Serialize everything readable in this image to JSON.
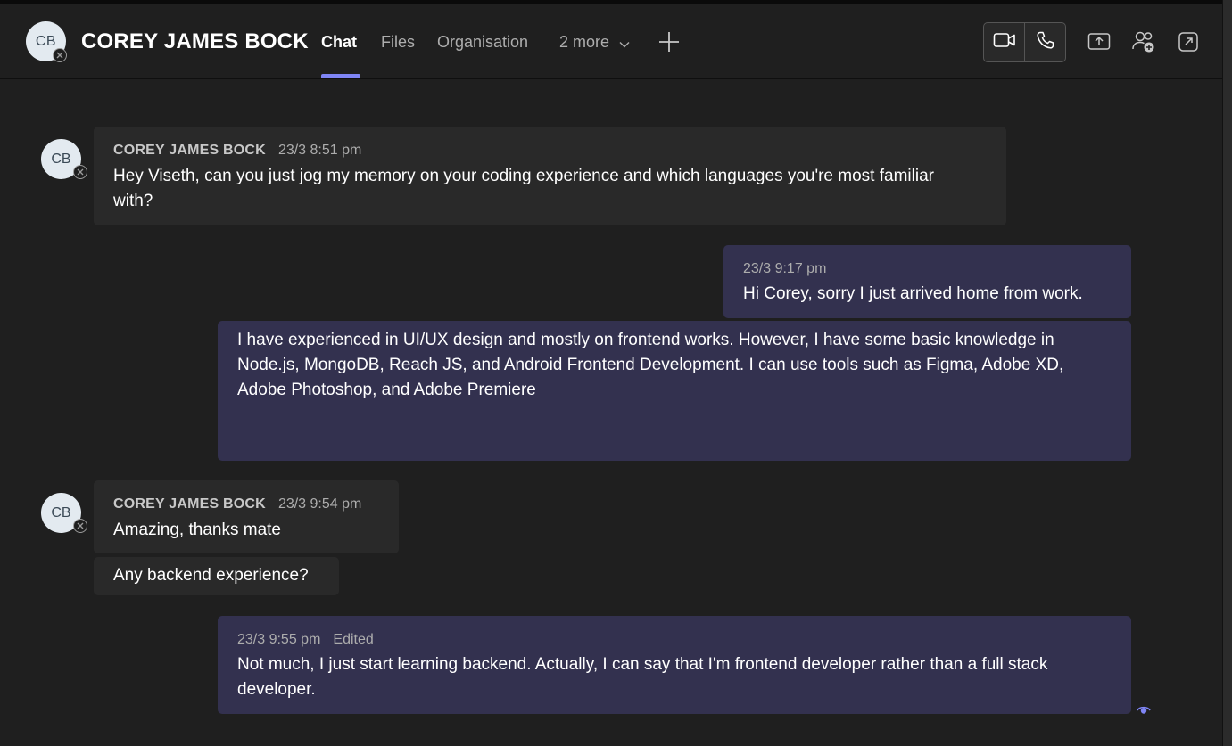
{
  "header": {
    "avatar_initials": "CB",
    "contact_name": "COREY JAMES BOCK",
    "tabs": [
      {
        "label": "Chat",
        "active": true
      },
      {
        "label": "Files",
        "active": false
      },
      {
        "label": "Organisation",
        "active": false
      },
      {
        "label": "2 more",
        "active": false
      }
    ],
    "icons": [
      "video-call-icon",
      "audio-call-icon",
      "share-screen-icon",
      "add-people-icon",
      "pop-out-icon",
      "add-tab-icon",
      "chevron-down-icon"
    ]
  },
  "colors": {
    "background": "#1f1f1f",
    "incoming_bubble": "#292929",
    "outgoing_bubble": "#33314f",
    "accent": "#7f85f5"
  },
  "messages": [
    {
      "direction": "incoming",
      "sender": "COREY JAMES BOCK",
      "time": "23/3 8:51 pm",
      "avatar": "CB",
      "text": "Hey Viseth, can you just jog my memory on your coding experience and which languages you're most familiar with?"
    },
    {
      "direction": "outgoing",
      "time": "23/3 9:17 pm",
      "text": "Hi Corey, sorry I just arrived home from work."
    },
    {
      "direction": "outgoing",
      "text": "I have experienced in UI/UX design and mostly on frontend works. However, I have some basic knowledge in Node.js, MongoDB, Reach JS, and Android Frontend Development. I can use tools such as Figma, Adobe XD, Adobe Photoshop, and Adobe Premiere"
    },
    {
      "direction": "incoming",
      "sender": "COREY JAMES BOCK",
      "time": "23/3 9:54 pm",
      "avatar": "CB",
      "text": "Amazing, thanks mate"
    },
    {
      "direction": "incoming",
      "text": "Any backend experience?"
    },
    {
      "direction": "outgoing",
      "time": "23/3 9:55 pm",
      "edited": "Edited",
      "text": "Not much, I just start learning backend. Actually, I can say that I'm frontend developer rather than a full stack developer."
    }
  ]
}
